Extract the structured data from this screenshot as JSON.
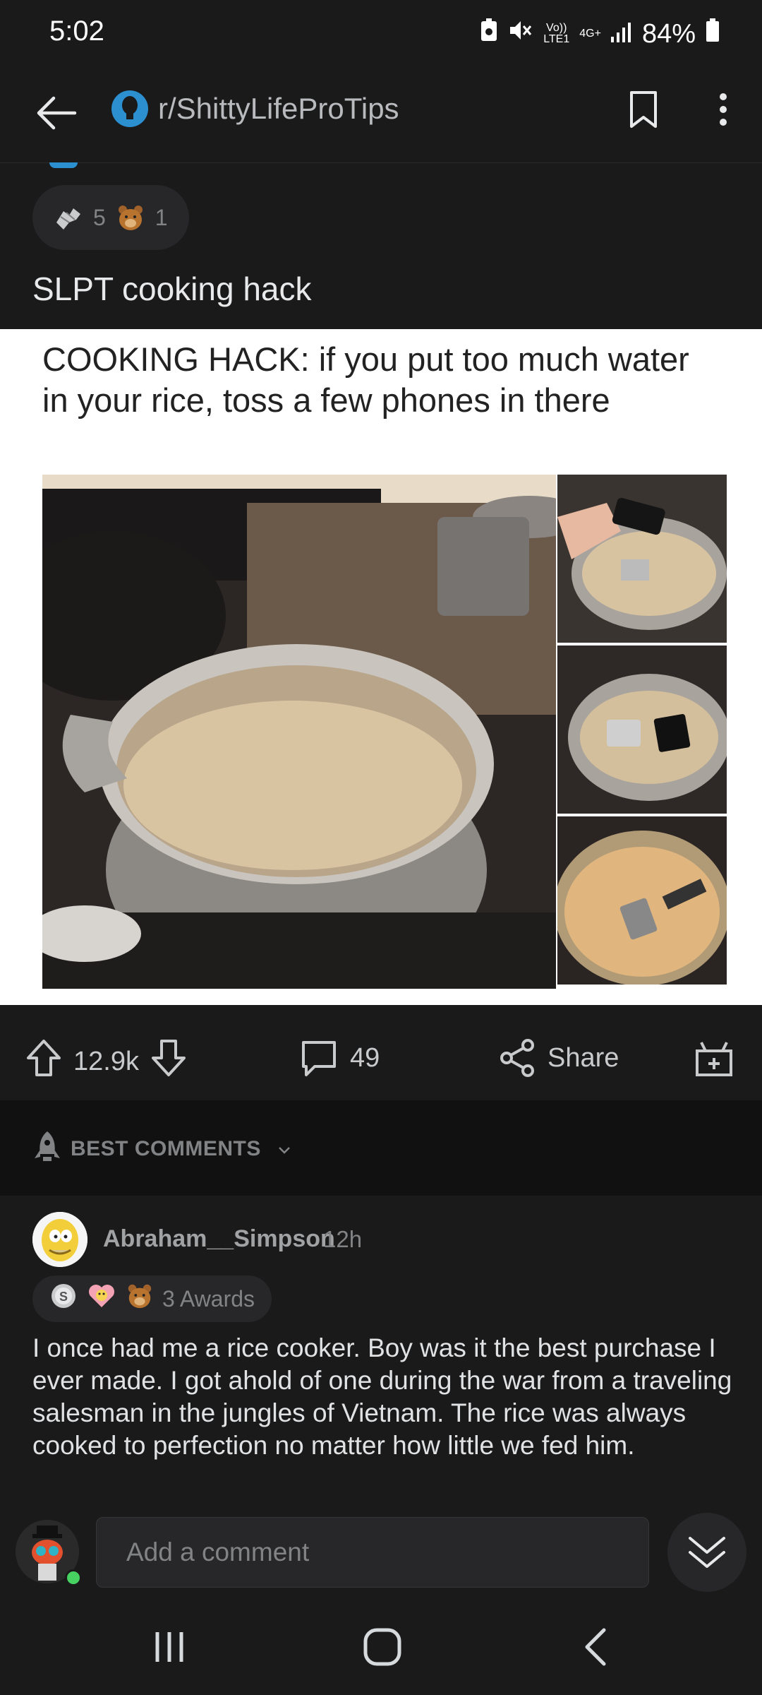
{
  "status": {
    "time": "5:02",
    "volte": "Vo))",
    "lte": "LTE1",
    "network": "4G+",
    "battery": "84%"
  },
  "header": {
    "subreddit": "r/ShittyLifeProTips"
  },
  "post": {
    "awards": [
      {
        "icon": "silver-hands-award-icon",
        "count": "5"
      },
      {
        "icon": "bear-award-icon",
        "count": "1"
      }
    ],
    "title": "SLPT cooking hack",
    "image_caption": "COOKING HACK: if you put too much water in your rice, toss a few phones in there"
  },
  "actions": {
    "upvotes": "12.9k",
    "comments": "49",
    "share": "Share"
  },
  "sort": {
    "label": "BEST COMMENTS"
  },
  "comment": {
    "author": "Abraham__Simpson",
    "time": "12h",
    "awards_label": "3 Awards",
    "body": "I once had me a rice cooker. Boy was it the best purchase I ever made. I got ahold of one during the war from a traveling salesman in the jungles of Vietnam. The rice was always cooked to perfection no matter how little we fed him."
  },
  "composer": {
    "placeholder": "Add a comment"
  },
  "colors": {
    "background": "#1a1a1b",
    "accent": "#2b8fd0",
    "online": "#46d160"
  }
}
